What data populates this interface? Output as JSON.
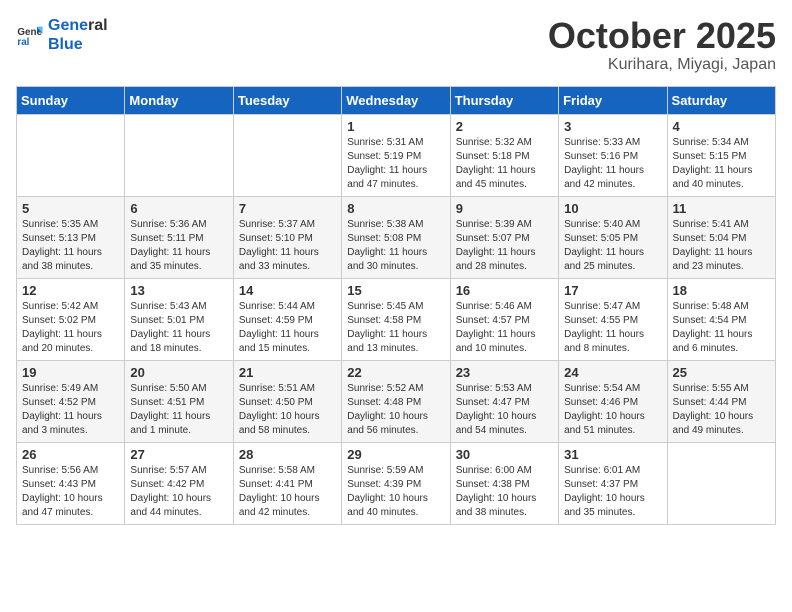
{
  "logo": {
    "line1": "General",
    "line2": "Blue"
  },
  "title": "October 2025",
  "subtitle": "Kurihara, Miyagi, Japan",
  "days_of_week": [
    "Sunday",
    "Monday",
    "Tuesday",
    "Wednesday",
    "Thursday",
    "Friday",
    "Saturday"
  ],
  "weeks": [
    [
      {
        "day": "",
        "info": ""
      },
      {
        "day": "",
        "info": ""
      },
      {
        "day": "",
        "info": ""
      },
      {
        "day": "1",
        "info": "Sunrise: 5:31 AM\nSunset: 5:19 PM\nDaylight: 11 hours\nand 47 minutes."
      },
      {
        "day": "2",
        "info": "Sunrise: 5:32 AM\nSunset: 5:18 PM\nDaylight: 11 hours\nand 45 minutes."
      },
      {
        "day": "3",
        "info": "Sunrise: 5:33 AM\nSunset: 5:16 PM\nDaylight: 11 hours\nand 42 minutes."
      },
      {
        "day": "4",
        "info": "Sunrise: 5:34 AM\nSunset: 5:15 PM\nDaylight: 11 hours\nand 40 minutes."
      }
    ],
    [
      {
        "day": "5",
        "info": "Sunrise: 5:35 AM\nSunset: 5:13 PM\nDaylight: 11 hours\nand 38 minutes."
      },
      {
        "day": "6",
        "info": "Sunrise: 5:36 AM\nSunset: 5:11 PM\nDaylight: 11 hours\nand 35 minutes."
      },
      {
        "day": "7",
        "info": "Sunrise: 5:37 AM\nSunset: 5:10 PM\nDaylight: 11 hours\nand 33 minutes."
      },
      {
        "day": "8",
        "info": "Sunrise: 5:38 AM\nSunset: 5:08 PM\nDaylight: 11 hours\nand 30 minutes."
      },
      {
        "day": "9",
        "info": "Sunrise: 5:39 AM\nSunset: 5:07 PM\nDaylight: 11 hours\nand 28 minutes."
      },
      {
        "day": "10",
        "info": "Sunrise: 5:40 AM\nSunset: 5:05 PM\nDaylight: 11 hours\nand 25 minutes."
      },
      {
        "day": "11",
        "info": "Sunrise: 5:41 AM\nSunset: 5:04 PM\nDaylight: 11 hours\nand 23 minutes."
      }
    ],
    [
      {
        "day": "12",
        "info": "Sunrise: 5:42 AM\nSunset: 5:02 PM\nDaylight: 11 hours\nand 20 minutes."
      },
      {
        "day": "13",
        "info": "Sunrise: 5:43 AM\nSunset: 5:01 PM\nDaylight: 11 hours\nand 18 minutes."
      },
      {
        "day": "14",
        "info": "Sunrise: 5:44 AM\nSunset: 4:59 PM\nDaylight: 11 hours\nand 15 minutes."
      },
      {
        "day": "15",
        "info": "Sunrise: 5:45 AM\nSunset: 4:58 PM\nDaylight: 11 hours\nand 13 minutes."
      },
      {
        "day": "16",
        "info": "Sunrise: 5:46 AM\nSunset: 4:57 PM\nDaylight: 11 hours\nand 10 minutes."
      },
      {
        "day": "17",
        "info": "Sunrise: 5:47 AM\nSunset: 4:55 PM\nDaylight: 11 hours\nand 8 minutes."
      },
      {
        "day": "18",
        "info": "Sunrise: 5:48 AM\nSunset: 4:54 PM\nDaylight: 11 hours\nand 6 minutes."
      }
    ],
    [
      {
        "day": "19",
        "info": "Sunrise: 5:49 AM\nSunset: 4:52 PM\nDaylight: 11 hours\nand 3 minutes."
      },
      {
        "day": "20",
        "info": "Sunrise: 5:50 AM\nSunset: 4:51 PM\nDaylight: 11 hours\nand 1 minute."
      },
      {
        "day": "21",
        "info": "Sunrise: 5:51 AM\nSunset: 4:50 PM\nDaylight: 10 hours\nand 58 minutes."
      },
      {
        "day": "22",
        "info": "Sunrise: 5:52 AM\nSunset: 4:48 PM\nDaylight: 10 hours\nand 56 minutes."
      },
      {
        "day": "23",
        "info": "Sunrise: 5:53 AM\nSunset: 4:47 PM\nDaylight: 10 hours\nand 54 minutes."
      },
      {
        "day": "24",
        "info": "Sunrise: 5:54 AM\nSunset: 4:46 PM\nDaylight: 10 hours\nand 51 minutes."
      },
      {
        "day": "25",
        "info": "Sunrise: 5:55 AM\nSunset: 4:44 PM\nDaylight: 10 hours\nand 49 minutes."
      }
    ],
    [
      {
        "day": "26",
        "info": "Sunrise: 5:56 AM\nSunset: 4:43 PM\nDaylight: 10 hours\nand 47 minutes."
      },
      {
        "day": "27",
        "info": "Sunrise: 5:57 AM\nSunset: 4:42 PM\nDaylight: 10 hours\nand 44 minutes."
      },
      {
        "day": "28",
        "info": "Sunrise: 5:58 AM\nSunset: 4:41 PM\nDaylight: 10 hours\nand 42 minutes."
      },
      {
        "day": "29",
        "info": "Sunrise: 5:59 AM\nSunset: 4:39 PM\nDaylight: 10 hours\nand 40 minutes."
      },
      {
        "day": "30",
        "info": "Sunrise: 6:00 AM\nSunset: 4:38 PM\nDaylight: 10 hours\nand 38 minutes."
      },
      {
        "day": "31",
        "info": "Sunrise: 6:01 AM\nSunset: 4:37 PM\nDaylight: 10 hours\nand 35 minutes."
      },
      {
        "day": "",
        "info": ""
      }
    ]
  ]
}
